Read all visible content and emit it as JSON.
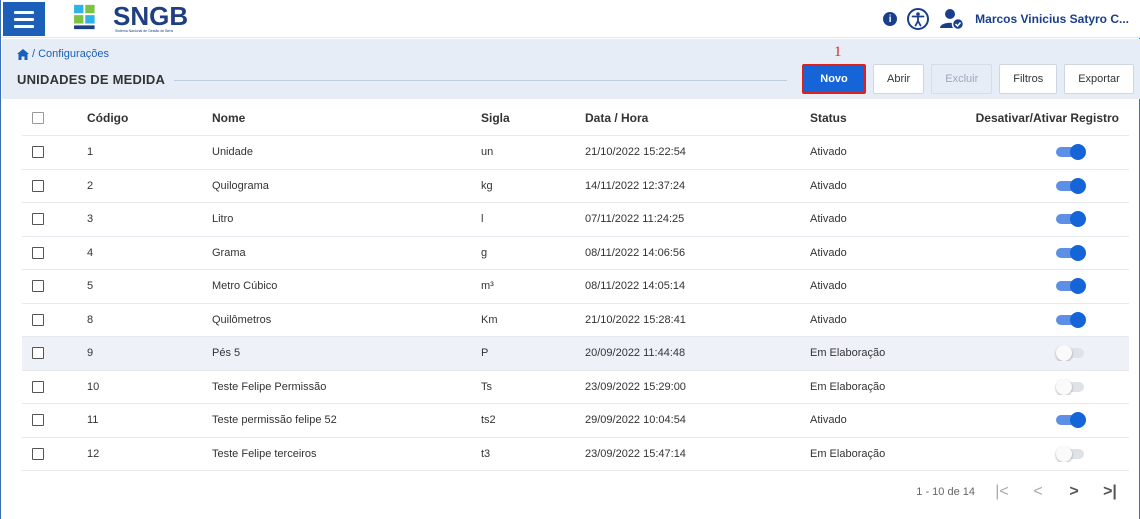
{
  "app": {
    "logo_text": "SNGB",
    "logo_subtitle": "Sistema Nacional de Gestão de Bens",
    "user_name": "Marcos Vinicius Satyro C...",
    "colors": {
      "primary": "#1565d8",
      "brand": "#1e3f82",
      "highlight": "#e0201c"
    }
  },
  "icons": {
    "menu": "hamburger-icon",
    "info": "info-icon",
    "accessibility": "accessibility-icon",
    "user": "user-check-icon",
    "home": "home-icon"
  },
  "breadcrumb": {
    "label": "/ Configurações"
  },
  "page": {
    "title": "UNIDADES DE MEDIDA"
  },
  "annotation": {
    "step": "1"
  },
  "toolbar": {
    "novo": "Novo",
    "abrir": "Abrir",
    "excluir": "Excluir",
    "filtros": "Filtros",
    "exportar": "Exportar"
  },
  "table": {
    "headers": {
      "codigo": "Código",
      "nome": "Nome",
      "sigla": "Sigla",
      "data": "Data / Hora",
      "status": "Status",
      "toggle": "Desativar/Ativar Registro"
    },
    "rows": [
      {
        "codigo": "1",
        "nome": "Unidade",
        "sigla": "un",
        "data": "21/10/2022 15:22:54",
        "status": "Ativado",
        "ativo": true
      },
      {
        "codigo": "2",
        "nome": "Quilograma",
        "sigla": "kg",
        "data": "14/11/2022 12:37:24",
        "status": "Ativado",
        "ativo": true
      },
      {
        "codigo": "3",
        "nome": "Litro",
        "sigla": "l",
        "data": "07/11/2022 11:24:25",
        "status": "Ativado",
        "ativo": true
      },
      {
        "codigo": "4",
        "nome": "Grama",
        "sigla": "g",
        "data": "08/11/2022 14:06:56",
        "status": "Ativado",
        "ativo": true
      },
      {
        "codigo": "5",
        "nome": "Metro Cúbico",
        "sigla": "m³",
        "data": "08/11/2022 14:05:14",
        "status": "Ativado",
        "ativo": true
      },
      {
        "codigo": "8",
        "nome": "Quilômetros",
        "sigla": "Km",
        "data": "21/10/2022 15:28:41",
        "status": "Ativado",
        "ativo": true
      },
      {
        "codigo": "9",
        "nome": "Pés 5",
        "sigla": "P",
        "data": "20/09/2022 11:44:48",
        "status": "Em Elaboração",
        "ativo": false,
        "highlight": true
      },
      {
        "codigo": "10",
        "nome": "Teste Felipe Permissão",
        "sigla": "Ts",
        "data": "23/09/2022 15:29:00",
        "status": "Em Elaboração",
        "ativo": false
      },
      {
        "codigo": "11",
        "nome": "Teste permissão felipe 52",
        "sigla": "ts2",
        "data": "29/09/2022 10:04:54",
        "status": "Ativado",
        "ativo": true
      },
      {
        "codigo": "12",
        "nome": "Teste Felipe terceiros",
        "sigla": "t3",
        "data": "23/09/2022 15:47:14",
        "status": "Em Elaboração",
        "ativo": false
      }
    ]
  },
  "pagination": {
    "range": "1 - 10 de 14",
    "first": "|<",
    "prev": "<",
    "next": ">",
    "last": ">|"
  }
}
